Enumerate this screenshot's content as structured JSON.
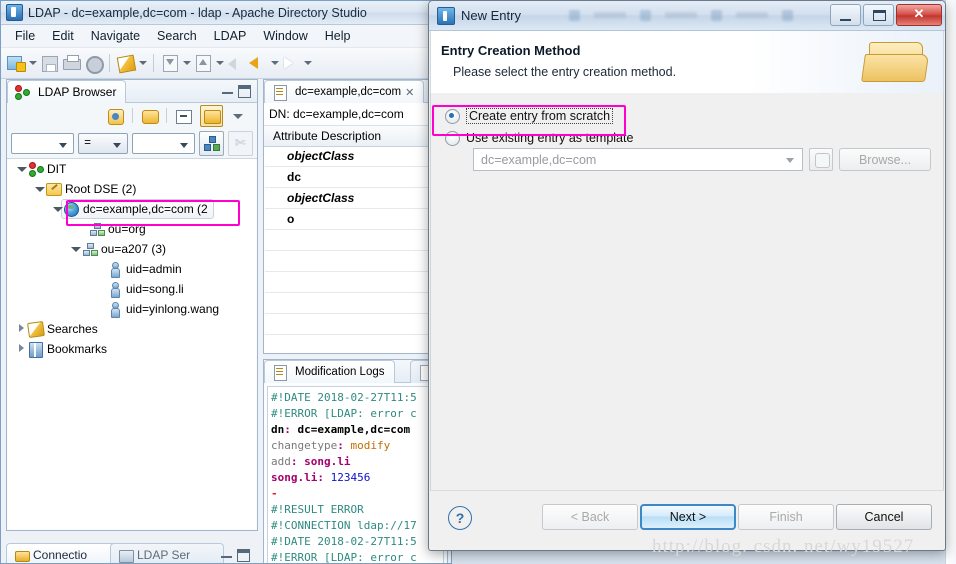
{
  "app": {
    "title": "LDAP - dc=example,dc=com - ldap - Apache Directory Studio",
    "icon": "app-icon",
    "menu": [
      "File",
      "Edit",
      "Navigate",
      "Search",
      "LDAP",
      "Window",
      "Help"
    ],
    "toolbar_icons": [
      "new-entry-icon",
      "dropdown-arrow",
      "save-icon",
      "print-icon",
      "properties-icon",
      "highlight-icon",
      "dropdown-arrow",
      "import-icon",
      "dropdown-arrow",
      "export-icon",
      "dropdown-arrow",
      "back-disabled-icon",
      "back-icon",
      "dropdown-arrow",
      "forward-icon",
      "dropdown-arrow"
    ]
  },
  "browser": {
    "tab_label": "LDAP Browser",
    "tab_icon": "ldap-browser-icon",
    "tools": [
      "refresh-icon",
      "link-with-editor-icon",
      "collapse-all-icon",
      "toggle-icon",
      "view-menu-icon"
    ],
    "filter": {
      "attribute_value": "",
      "operator_value": "=",
      "value_value": "",
      "tree_button_icon": "quick-filter-icon",
      "clear_button_icon": "clear-filter-icon"
    },
    "tree": [
      {
        "label": "DIT",
        "indent": 0,
        "twist": "open",
        "icon": "dit-icon"
      },
      {
        "label": "Root DSE (2)",
        "indent": 1,
        "twist": "open",
        "icon": "root-dse-icon"
      },
      {
        "label": "dc=example,dc=com (2",
        "indent": 2,
        "twist": "open",
        "icon": "entry-globe-icon",
        "selected": true,
        "highlight": true
      },
      {
        "label": "ou=org",
        "indent": 3,
        "twist": "none",
        "icon": "ou-icon"
      },
      {
        "label": "ou=a207 (3)",
        "indent": 3,
        "twist": "open",
        "icon": "ou-icon"
      },
      {
        "label": "uid=admin",
        "indent": 4,
        "twist": "none",
        "icon": "person-icon"
      },
      {
        "label": "uid=song.li",
        "indent": 4,
        "twist": "none",
        "icon": "person-icon"
      },
      {
        "label": "uid=yinlong.wang",
        "indent": 4,
        "twist": "none",
        "icon": "person-icon"
      },
      {
        "label": "Searches",
        "indent": 0,
        "twist": "closed",
        "icon": "searches-icon"
      },
      {
        "label": "Bookmarks",
        "indent": 0,
        "twist": "closed",
        "icon": "bookmarks-icon"
      }
    ],
    "bottom_tabs": [
      {
        "label": "Connectio",
        "icon": "connections-icon",
        "active": true
      },
      {
        "label": "LDAP Ser",
        "icon": "ldap-servers-icon",
        "active": false
      }
    ]
  },
  "editor": {
    "tab_label": "dc=example,dc=com",
    "tab_icon": "entry-editor-icon",
    "dn_line": "DN: dc=example,dc=com",
    "column_header": "Attribute Description",
    "rows": [
      {
        "value": "objectClass",
        "style": "italic-bold"
      },
      {
        "value": "dc",
        "style": "bold"
      },
      {
        "value": "objectClass",
        "style": "italic-bold"
      },
      {
        "value": "o",
        "style": "bold"
      },
      {
        "value": "",
        "style": "plain"
      },
      {
        "value": "",
        "style": "plain"
      },
      {
        "value": "",
        "style": "plain"
      },
      {
        "value": "",
        "style": "plain"
      },
      {
        "value": "",
        "style": "plain"
      },
      {
        "value": "",
        "style": "plain"
      }
    ]
  },
  "logs": {
    "tab_label": "Modification Logs",
    "tab_icon": "modification-logs-icon",
    "tab2_icon": "search-logs-icon",
    "lines": [
      [
        {
          "t": "#!DATE 2018-02-27T11:5",
          "c": "lg-c"
        }
      ],
      [
        {
          "t": "#!ERROR [LDAP: error c",
          "c": "lg-c"
        }
      ],
      [
        {
          "t": "dn",
          "c": "lg-dn"
        },
        {
          "t": ":",
          "c": "lg-m"
        },
        {
          "t": " dc=example,dc=com",
          "c": "lg-dn"
        }
      ],
      [
        {
          "t": "changetype",
          "c": "lg-k"
        },
        {
          "t": ":",
          "c": "lg-m"
        },
        {
          "t": " modify",
          "c": "lg-v"
        }
      ],
      [
        {
          "t": "add",
          "c": "lg-k"
        },
        {
          "t": ":",
          "c": "lg-m"
        },
        {
          "t": " song.li",
          "c": "lg-m"
        }
      ],
      [
        {
          "t": "song.li",
          "c": "lg-m"
        },
        {
          "t": ":",
          "c": "lg-m"
        },
        {
          "t": " 123456",
          "c": "lg-n"
        }
      ],
      [
        {
          "t": "-",
          "c": "lg-r"
        }
      ],
      [
        {
          "t": " ",
          "c": "lg-c"
        }
      ],
      [
        {
          "t": "#!RESULT ERROR",
          "c": "lg-c"
        }
      ],
      [
        {
          "t": "#!CONNECTION ldap://17",
          "c": "lg-c"
        }
      ],
      [
        {
          "t": "#!DATE 2018-02-27T11:5",
          "c": "lg-c"
        }
      ],
      [
        {
          "t": "#!ERROR [LDAP: error c",
          "c": "lg-c"
        }
      ]
    ]
  },
  "dialog": {
    "title": "New Entry",
    "title_icon": "new-entry-window-icon",
    "sys": {
      "minimize": "minimize-icon",
      "maximize": "maximize-icon",
      "close": "✕"
    },
    "heading": "Entry Creation Method",
    "subheading": "Please select the entry creation method.",
    "header_icon": "folder-icon",
    "options": [
      {
        "label": "Create entry from scratch",
        "selected": true,
        "focused": true,
        "highlight": true
      },
      {
        "label": "Use existing entry as template",
        "selected": false,
        "focused": false,
        "highlight": false
      }
    ],
    "template": {
      "combo_value": "dc=example,dc=com",
      "picker_icon": "entry-picker-icon",
      "browse_label": "Browse..."
    },
    "footer": {
      "help_icon": "?",
      "buttons": [
        {
          "label": "< Back",
          "state": "disabled"
        },
        {
          "label": "Next >",
          "state": "default"
        },
        {
          "label": "Finish",
          "state": "disabled"
        },
        {
          "label": "Cancel",
          "state": "enabled"
        }
      ]
    }
  },
  "watermark": {
    "text": "http://blog. csdn. net/wy19527"
  },
  "colors": {
    "highlight_magenta": "#ff00d0",
    "default_button_blue": "#3c87c8",
    "log_comment": "#2e8b80",
    "log_value": "#c07000",
    "log_number": "#1111cc"
  }
}
